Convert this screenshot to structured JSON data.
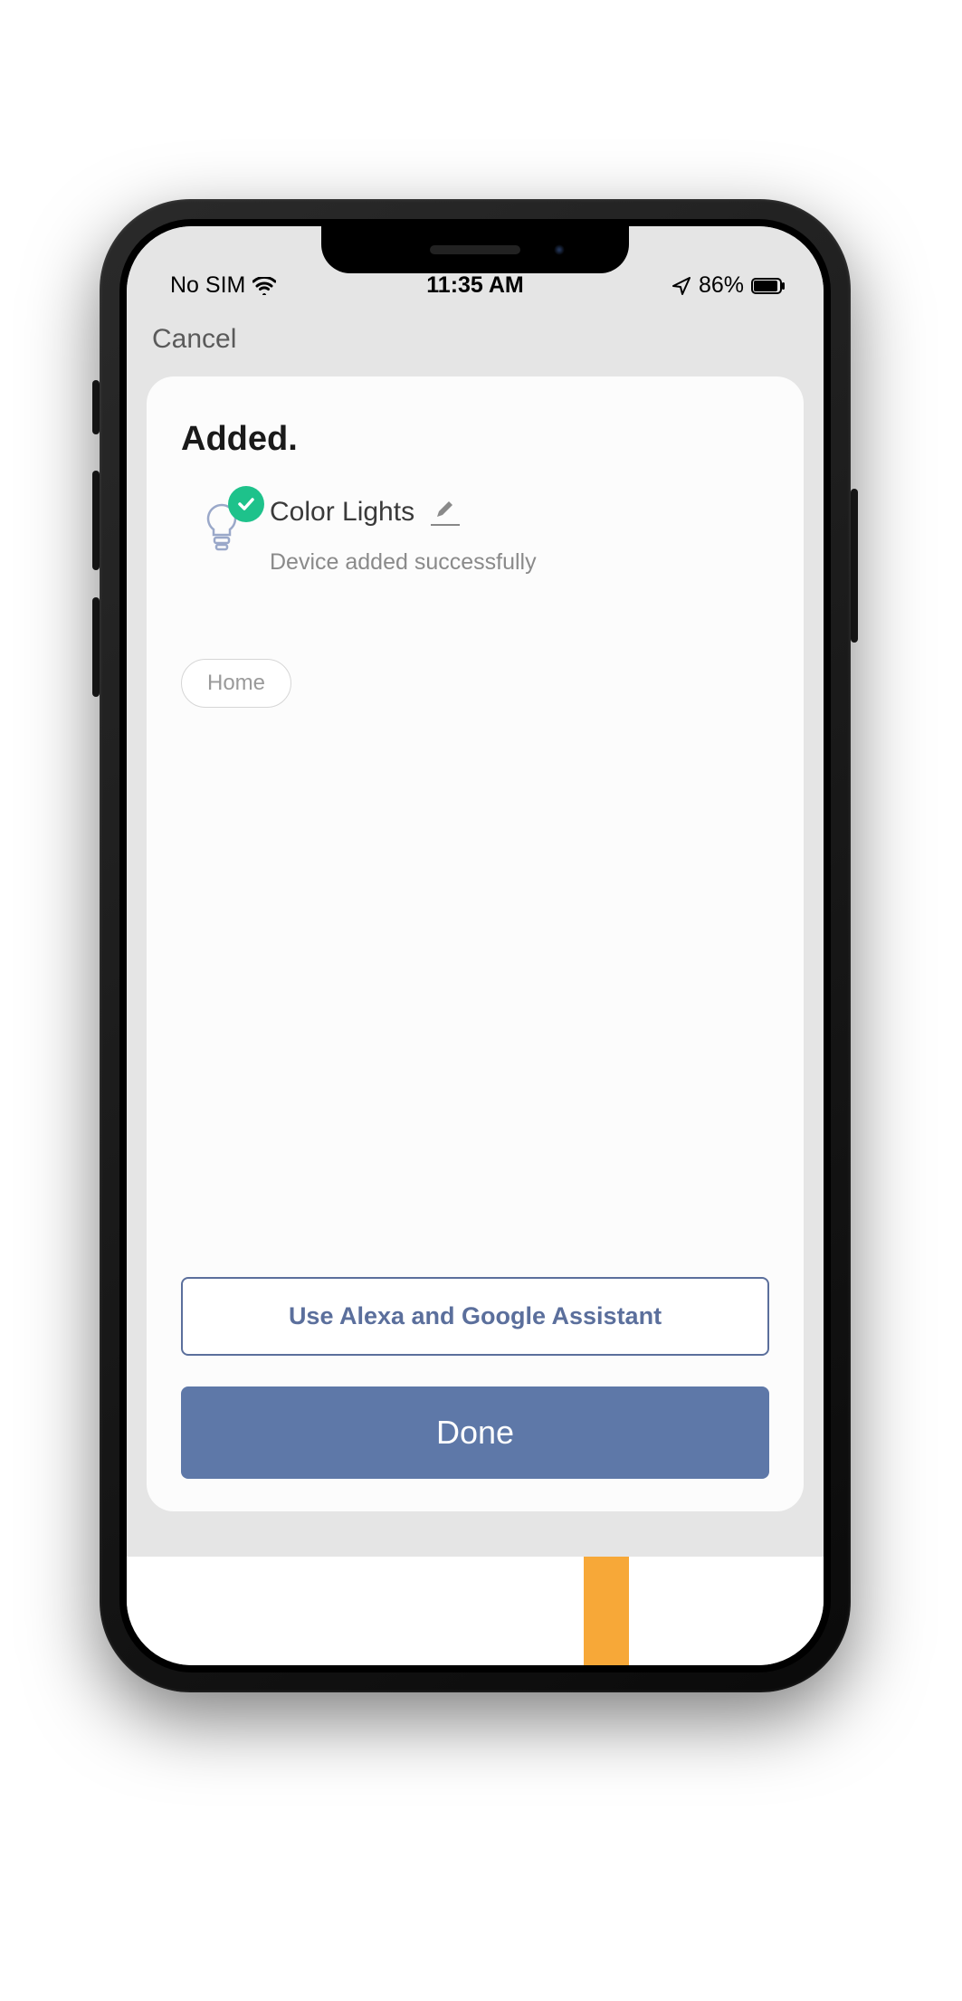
{
  "statusbar": {
    "carrier": "No SIM",
    "time": "11:35 AM",
    "battery_pct": "86%"
  },
  "nav": {
    "cancel_label": "Cancel"
  },
  "card": {
    "title": "Added.",
    "device_name": "Color Lights",
    "success_msg": "Device added successfully",
    "chip_home": "Home",
    "assistant_label": "Use Alexa and Google Assistant",
    "done_label": "Done"
  },
  "colors": {
    "accent_green": "#1ec28b",
    "button_blue": "#5e78a8",
    "outline_blue": "#5b6f9c",
    "orange": "#f7a838"
  }
}
